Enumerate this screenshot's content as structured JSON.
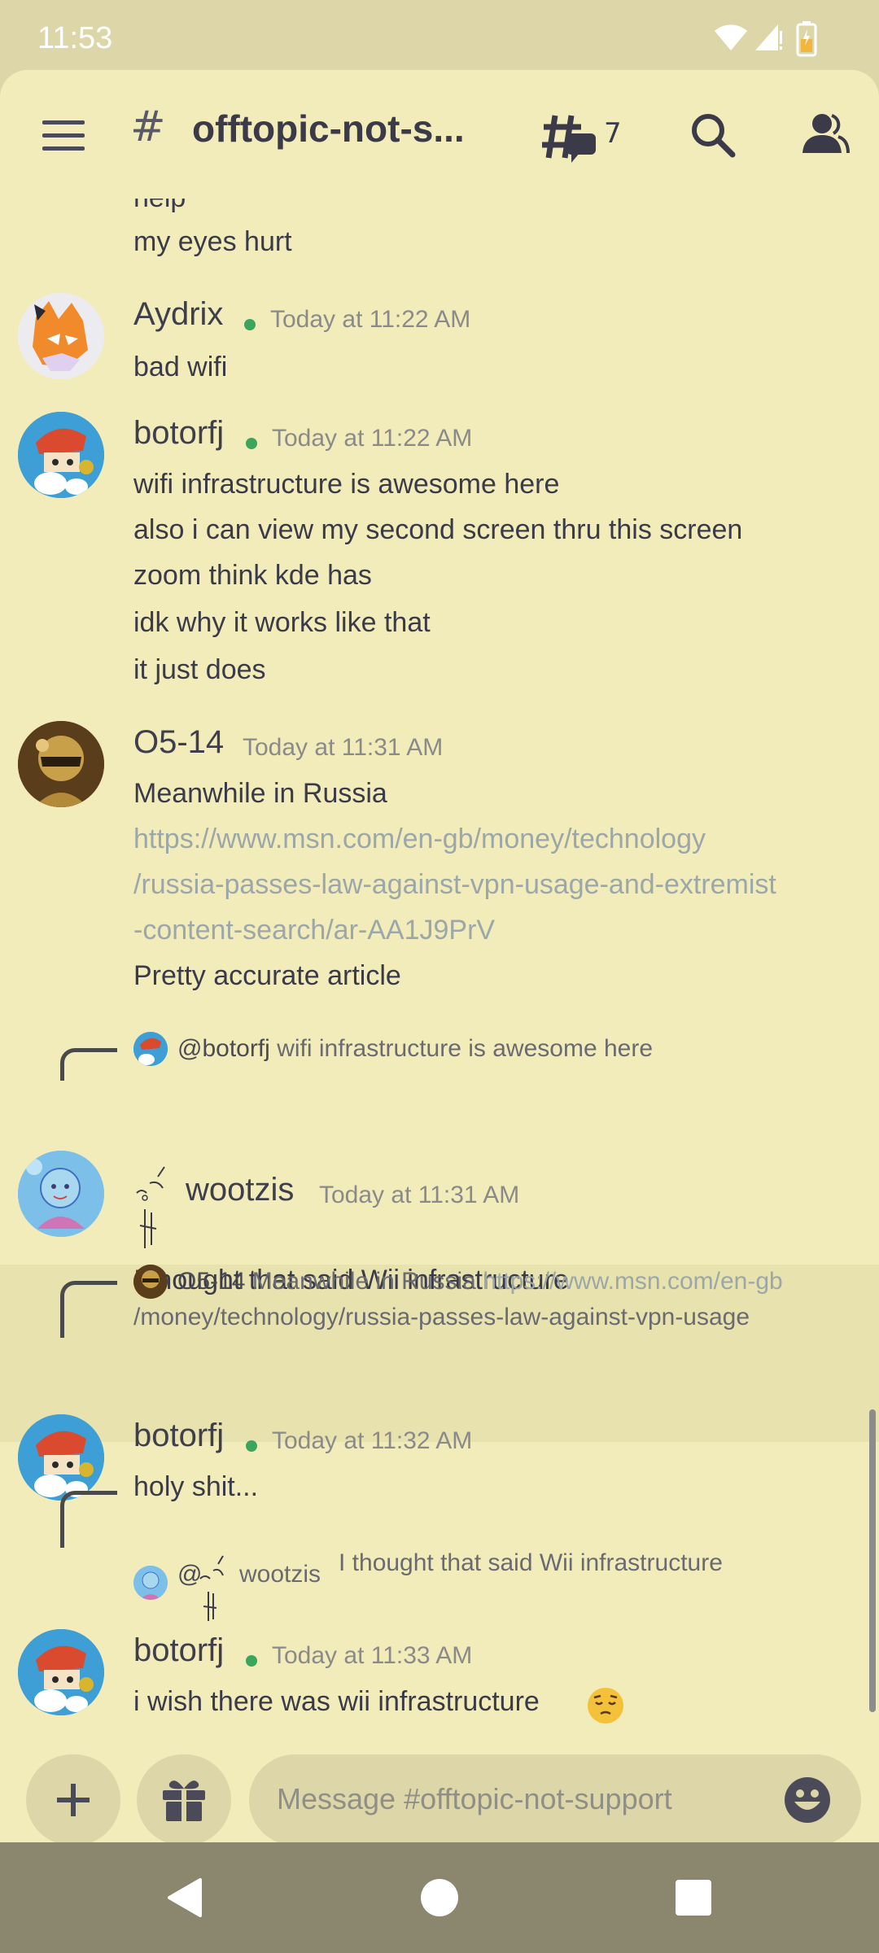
{
  "status_bar": {
    "time": "11:53"
  },
  "header": {
    "hash": "#",
    "channel_title": "offtopic-not-s...",
    "threads_count": "7"
  },
  "messages": [
    {
      "lines": [
        "help",
        "my eyes hurt"
      ]
    },
    {
      "author": "Aydrix",
      "time": "Today at 11:22 AM",
      "lines": [
        "bad wifi"
      ]
    },
    {
      "author": "botorfj",
      "time": "Today at 11:22 AM",
      "lines": [
        "wifi infrastructure is awesome here",
        "also i can view my second screen thru this screen",
        "zoom think kde has",
        "idk why it works like that",
        "it just does"
      ]
    },
    {
      "author": "O5-14",
      "time": "Today at 11:31 AM",
      "lines": [
        "Meanwhile in Russia"
      ],
      "link_lines": [
        "https://www.msn.com/en-gb/money/technology",
        "/russia-passes-law-against-vpn-usage-and-extremist",
        "-content-search/ar-AA1J9PrV"
      ],
      "after_link": "Pretty accurate article"
    },
    {
      "reply_to": "@botorfj",
      "reply_text": "wifi infrastructure is awesome here",
      "author": "wootzis",
      "time": "Today at 11:31 AM",
      "lines": [
        "I thought that said Wii infrastructure"
      ]
    },
    {
      "reply_to": "O5-14",
      "reply_text": "Meanwhile in Russia",
      "reply_link_1": "https://www.msn.com/en-gb",
      "reply_link_2": "/money/technology/russia-passes-law-against-vpn-usage",
      "author": "botorfj",
      "time": "Today at 11:32 AM",
      "lines": [
        "holy shit..."
      ]
    },
    {
      "reply_to": "@",
      "reply_to_name": "wootzis",
      "reply_text": "I thought that said Wii infrastructure",
      "author": "botorfj",
      "time": "Today at 11:33 AM",
      "lines": [
        "i wish there was wii infrastructure"
      ]
    }
  ],
  "composer": {
    "placeholder": "Message #offtopic-not-support"
  },
  "colors": {
    "background": "#f2ecbb",
    "status_bar": "#ddd6a8",
    "online": "#3ba55d",
    "link": "#9ba7a8",
    "nav_bar": "#8b866e"
  }
}
